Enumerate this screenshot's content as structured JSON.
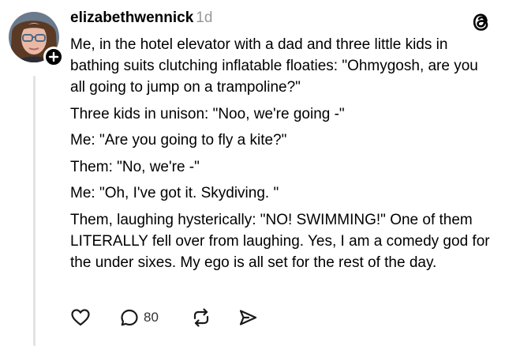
{
  "post": {
    "username": "elizabethwennick",
    "timestamp": "1d",
    "paragraphs": [
      "Me, in the hotel elevator with a dad and three little kids in bathing suits clutching inflatable floaties: \"Ohmygosh, are you all going to jump on a trampoline?\"",
      "Three kids in unison: \"Noo, we're going -\"",
      "Me: \"Are you going to fly a kite?\"",
      "Them: \"No, we're -\"",
      "Me: \"Oh, I've got it. Skydiving. \"",
      "Them, laughing hysterically: \"NO! SWIMMING!\" One of them LITERALLY fell over from laughing. Yes, I am a comedy god for the under sixes. My ego is all set for the rest of the day."
    ],
    "reply_count": "80"
  },
  "icons": {
    "avatar": "user-avatar",
    "follow": "plus-icon",
    "brand": "threads-logo-icon",
    "like": "heart-icon",
    "reply": "comment-bubble-icon",
    "repost": "repost-arrows-icon",
    "share": "send-icon"
  },
  "colors": {
    "text": "#000000",
    "muted": "#999999",
    "thread_line": "#e3e3e3",
    "icon": "#1a1a1a"
  }
}
